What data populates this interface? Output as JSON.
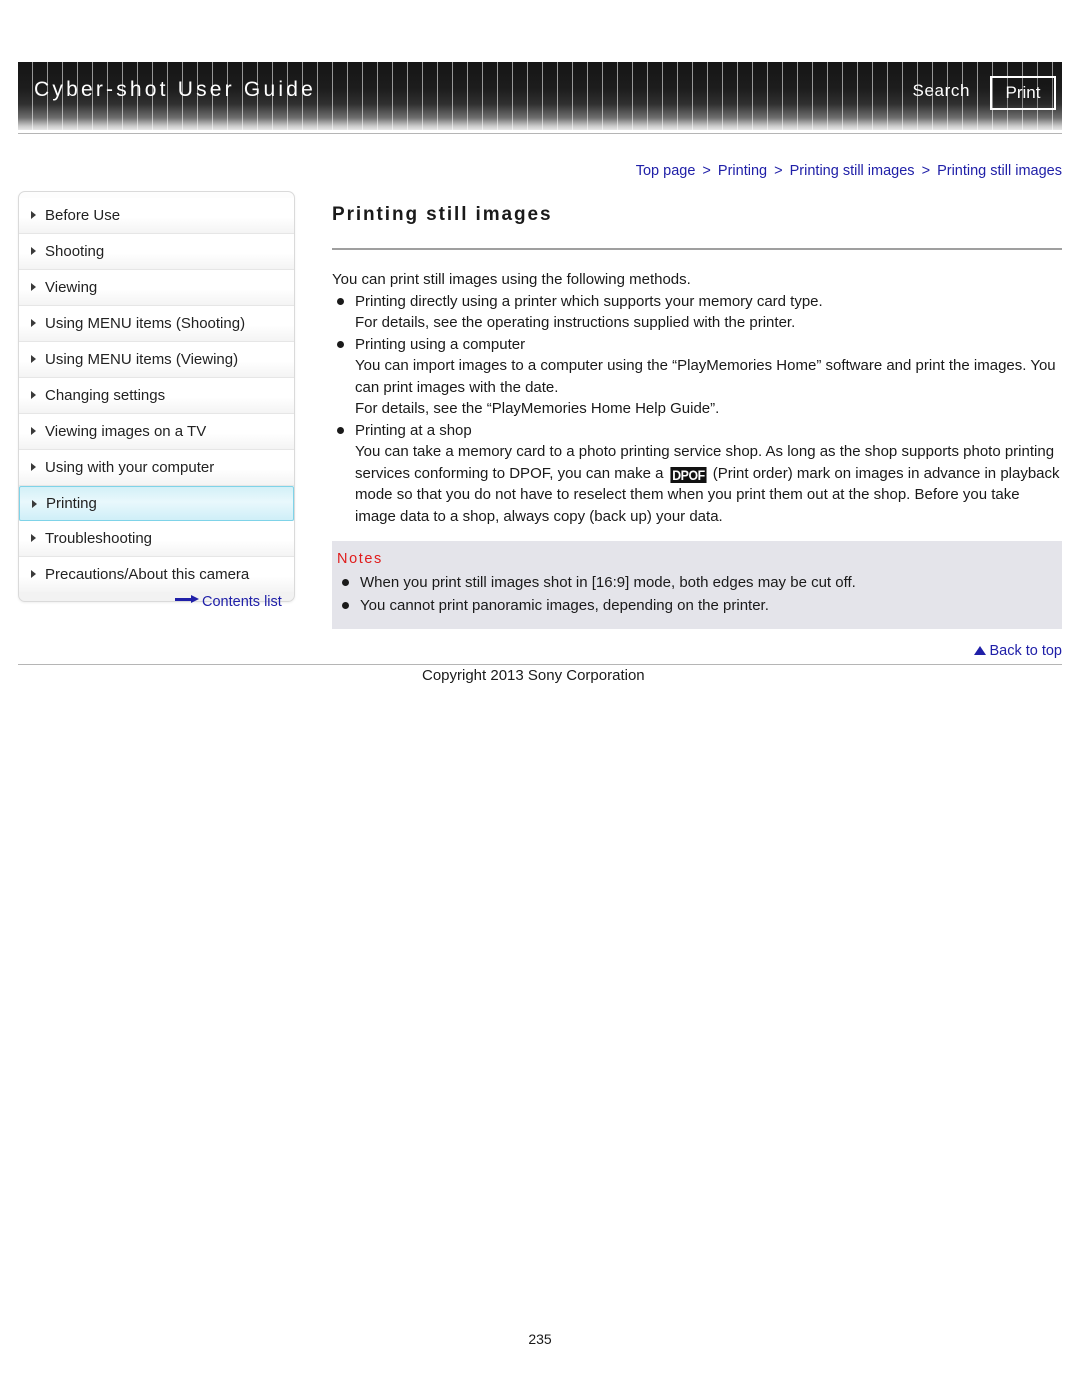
{
  "header": {
    "title": "Cyber-shot User Guide",
    "search_label": "Search",
    "print_label": "Print"
  },
  "breadcrumb": {
    "items": [
      {
        "label": "Top page"
      },
      {
        "label": "Printing"
      },
      {
        "label": "Printing still images"
      },
      {
        "label": "Printing still images"
      }
    ],
    "separator": ">"
  },
  "sidebar": {
    "items": [
      {
        "label": "Before Use",
        "active": false
      },
      {
        "label": "Shooting",
        "active": false
      },
      {
        "label": "Viewing",
        "active": false
      },
      {
        "label": "Using MENU items (Shooting)",
        "active": false
      },
      {
        "label": "Using MENU items (Viewing)",
        "active": false
      },
      {
        "label": "Changing settings",
        "active": false
      },
      {
        "label": "Viewing images on a TV",
        "active": false
      },
      {
        "label": "Using with your computer",
        "active": false
      },
      {
        "label": "Printing",
        "active": true
      },
      {
        "label": "Troubleshooting",
        "active": false
      },
      {
        "label": "Precautions/About this camera",
        "active": false
      }
    ],
    "contents_list_label": "Contents list"
  },
  "main": {
    "page_title": "Printing still images",
    "intro": "You can print still images using the following methods.",
    "methods": [
      {
        "heading": "Printing directly using a printer which supports your memory card type.",
        "lines": [
          "For details, see the operating instructions supplied with the printer."
        ]
      },
      {
        "heading": "Printing using a computer",
        "lines": [
          "You can import images to a computer using the “PlayMemories Home” software and print the images. You can print images with the date.",
          "For details, see the “PlayMemories Home Help Guide”."
        ]
      },
      {
        "heading": "Printing at a shop",
        "lines": []
      }
    ],
    "shop_text_before_logo": "You can take a memory card to a photo printing service shop. As long as the shop supports photo printing services conforming to DPOF, you can make a ",
    "dpof_logo_text": "DPOF",
    "shop_text_after_logo": " (Print order) mark on images in advance in playback mode so that you do not have to reselect them when you print them out at the shop. Before you take image data to a shop, always copy (back up) your data."
  },
  "notes": {
    "title": "Notes",
    "items": [
      "When you print still images shot in [16:9] mode, both edges may be cut off.",
      "You cannot print panoramic images, depending on the printer."
    ]
  },
  "footer": {
    "back_to_top_label": "Back to top",
    "copyright": "Copyright 2013 Sony Corporation",
    "page_number": "235"
  },
  "colors": {
    "link": "#2020a8",
    "notes_title": "#e01b1b",
    "active_nav_border": "#7fd3e8",
    "notes_background": "#e4e4ea"
  }
}
